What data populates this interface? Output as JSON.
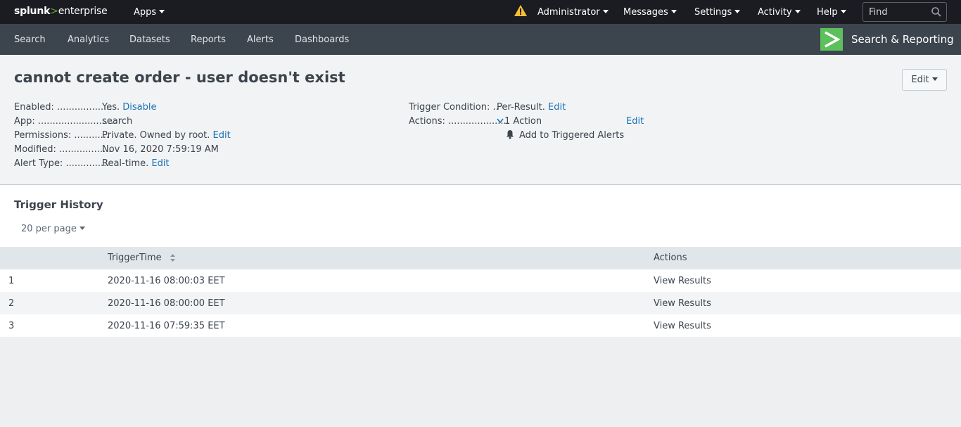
{
  "topbar": {
    "logo_splunk": "splunk",
    "logo_gt": ">",
    "logo_enterprise": "enterprise",
    "apps_label": "Apps",
    "user_label": "Administrator",
    "messages_label": "Messages",
    "settings_label": "Settings",
    "activity_label": "Activity",
    "help_label": "Help",
    "find_placeholder": "Find",
    "warning_color": "#f8be34"
  },
  "nav": {
    "items": [
      "Search",
      "Analytics",
      "Datasets",
      "Reports",
      "Alerts",
      "Dashboards"
    ],
    "app_title": "Search & Reporting",
    "app_badge_color": "#5cc05c"
  },
  "alert": {
    "title": "cannot create order - user doesn't exist",
    "edit_button": "Edit",
    "left_details": [
      {
        "label": "Enabled: ...................",
        "value": "Yes.",
        "link": "Disable"
      },
      {
        "label": "App: ...........................",
        "value": "search",
        "link": ""
      },
      {
        "label": "Permissions: ............",
        "value": "Private. Owned by root.",
        "link": "Edit"
      },
      {
        "label": "Modified: ..................",
        "value": "Nov 16, 2020 7:59:19 AM",
        "link": ""
      },
      {
        "label": "Alert Type: ...............",
        "value": "Real-time.",
        "link": "Edit"
      }
    ],
    "trigger_condition_label": "Trigger Condition: ..",
    "trigger_condition_value": "Per-Result.",
    "trigger_condition_link": "Edit",
    "actions_label": "Actions: .....................",
    "actions_value": "1 Action",
    "actions_link": "Edit",
    "action_item": "Add to Triggered Alerts"
  },
  "history": {
    "title": "Trigger History",
    "per_page": "20 per page",
    "columns": {
      "index": "",
      "trigger_time": "TriggerTime",
      "actions": "Actions"
    },
    "rows": [
      {
        "index": "1",
        "time": "2020-11-16 08:00:03 EET",
        "action": "View Results"
      },
      {
        "index": "2",
        "time": "2020-11-16 08:00:00 EET",
        "action": "View Results"
      },
      {
        "index": "3",
        "time": "2020-11-16 07:59:35 EET",
        "action": "View Results"
      }
    ]
  }
}
